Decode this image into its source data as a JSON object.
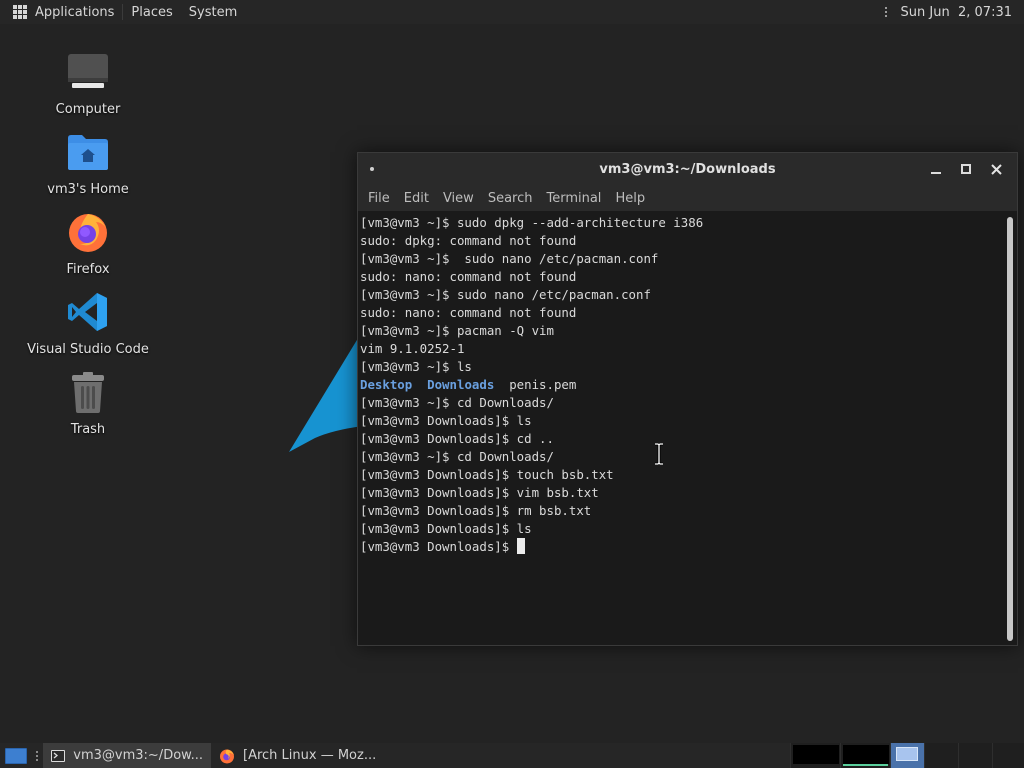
{
  "top_panel": {
    "menus": [
      "Applications",
      "Places",
      "System"
    ],
    "clock": "Sun Jun  2, 07:31"
  },
  "desktop_icons": [
    {
      "label": "Computer",
      "icon": "computer-icon"
    },
    {
      "label": "vm3's Home",
      "icon": "home-folder-icon"
    },
    {
      "label": "Firefox",
      "icon": "firefox-icon"
    },
    {
      "label": "Visual Studio Code",
      "icon": "vscode-icon"
    },
    {
      "label": "Trash",
      "icon": "trash-icon"
    }
  ],
  "terminal": {
    "title": "vm3@vm3:~/Downloads",
    "menu": [
      "File",
      "Edit",
      "View",
      "Search",
      "Terminal",
      "Help"
    ],
    "lines": [
      "[vm3@vm3 ~]$ sudo dpkg --add-architecture i386",
      "sudo: dpkg: command not found",
      "[vm3@vm3 ~]$  sudo nano /etc/pacman.conf",
      "sudo: nano: command not found",
      "[vm3@vm3 ~]$ sudo nano /etc/pacman.conf",
      "sudo: nano: command not found",
      "[vm3@vm3 ~]$ pacman -Q vim",
      "vim 9.1.0252-1",
      "[vm3@vm3 ~]$ ls",
      "__LS__",
      "[vm3@vm3 ~]$ cd Downloads/",
      "[vm3@vm3 Downloads]$ ls",
      "[vm3@vm3 Downloads]$ cd ..",
      "[vm3@vm3 ~]$ cd Downloads/",
      "[vm3@vm3 Downloads]$ touch bsb.txt",
      "[vm3@vm3 Downloads]$ vim bsb.txt",
      "[vm3@vm3 Downloads]$ rm bsb.txt",
      "[vm3@vm3 Downloads]$ ls"
    ],
    "ls_output": {
      "dirs": [
        "Desktop",
        "Downloads"
      ],
      "files": [
        "penis.pem"
      ]
    },
    "prompt": "[vm3@vm3 Downloads]$ "
  },
  "taskbar": {
    "tasks": [
      {
        "label": "vm3@vm3:~/Dow...",
        "icon": "terminal-icon",
        "active": true
      },
      {
        "label": "[Arch Linux — Moz...",
        "icon": "firefox-icon",
        "active": false
      }
    ]
  },
  "colors": {
    "desktop_bg": "#232323",
    "directory_text": "#6aa0e0",
    "workspace_active": "#5acf9c",
    "arch_blue": "#1793d1"
  }
}
